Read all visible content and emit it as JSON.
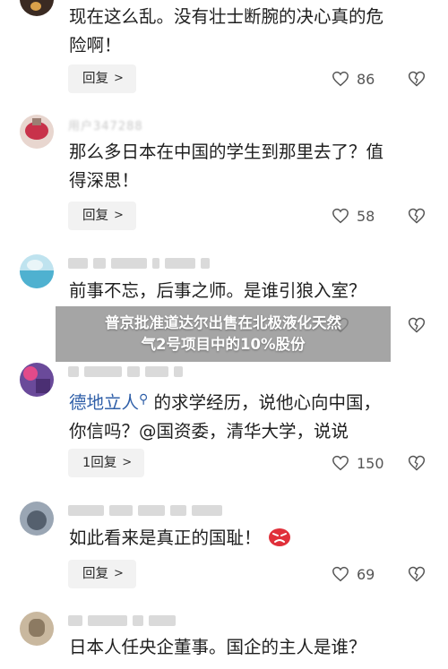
{
  "comments": [
    {
      "text": "现在这么乱。没有壮士断腕的决心真的危险啊！",
      "line1": "现在这么乱。没有壮士断腕的决心真的危",
      "line2": "险啊！",
      "reply_label": "回复",
      "likes": "86"
    },
    {
      "username": "用户347288",
      "line1": "那么多日本在中国的学生到那里去了？值",
      "line2": "得深思！",
      "reply_label": "回复",
      "likes": "58"
    },
    {
      "line1": "前事不忘，后事之师。是谁引狼入室？",
      "reply_label": "回复",
      "likes": "?"
    },
    {
      "mention": "德地立人",
      "line1_rest": "的求学经历，说他心向中国，",
      "line2": "你信吗？@国资委，清华大学，说说",
      "reply_label": "1回复",
      "likes": "150"
    },
    {
      "line1": "如此看来是真正的国耻！",
      "emoji": "angry-face-emoji",
      "reply_label": "回复",
      "likes": "69"
    },
    {
      "line1": "日本人任央企董事。国企的主人是谁？"
    }
  ],
  "overlay": {
    "line1": "普京批准道达尔出售在北极液化天然",
    "line2": "气2号项目中的10%股份"
  },
  "icons": {
    "like": "heart-icon",
    "dislike": "broken-heart-icon",
    "reply_chevron": "chevron-right-icon"
  },
  "colors": {
    "text": "#1f1f1f",
    "mention": "#2f5fa8",
    "reply_bg": "#f2f2f2",
    "overlay_bg": "#8c8c8c"
  }
}
